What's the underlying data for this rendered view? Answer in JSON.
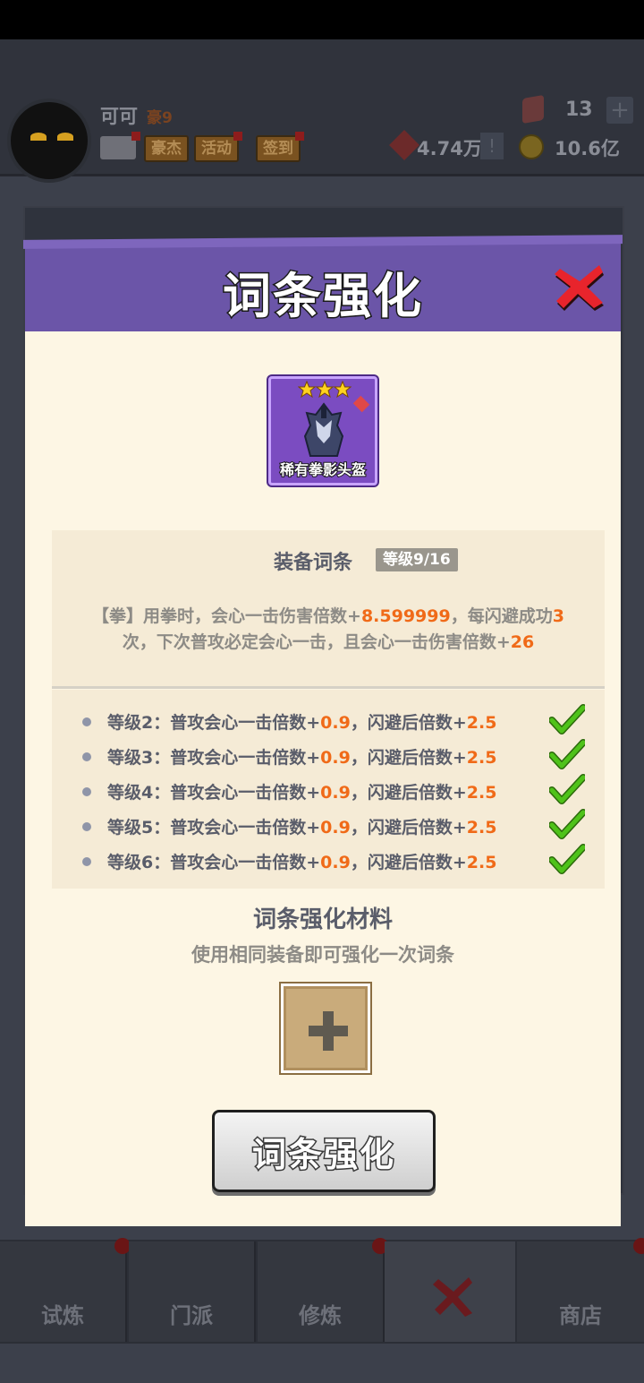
{
  "hud": {
    "player_name": "可可",
    "vip_label": "豪9",
    "tags": [
      "豪杰",
      "活动",
      "签到"
    ],
    "gem_count": "13",
    "plus_label": "+",
    "power_value": "4.74万",
    "excl_label": "!",
    "coin_value": "10.6亿"
  },
  "dialog": {
    "title": "词条强化",
    "item": {
      "name": "稀有拳影头盔",
      "stars": 3
    },
    "affix": {
      "title": "装备词条",
      "level_badge": "等级9/16",
      "desc": {
        "p1": "【拳】用拳时，会心一击伤害倍数+",
        "v1": "8.599999",
        "p2": "，每闪避成功",
        "v2": "3",
        "p3": "次，下次普攻必定会心一击，且会心一击伤害倍数+",
        "v3": "26"
      }
    },
    "levels": [
      {
        "prefix": "等级2：普攻会心一击倍数+",
        "v1": "0.9",
        "mid": "，闪避后倍数+",
        "v2": "2.5",
        "done": true
      },
      {
        "prefix": "等级3：普攻会心一击倍数+",
        "v1": "0.9",
        "mid": "，闪避后倍数+",
        "v2": "2.5",
        "done": true
      },
      {
        "prefix": "等级4：普攻会心一击倍数+",
        "v1": "0.9",
        "mid": "，闪避后倍数+",
        "v2": "2.5",
        "done": true
      },
      {
        "prefix": "等级5：普攻会心一击倍数+",
        "v1": "0.9",
        "mid": "，闪避后倍数+",
        "v2": "2.5",
        "done": true
      },
      {
        "prefix": "等级6：普攻会心一击倍数+",
        "v1": "0.9",
        "mid": "，闪避后倍数+",
        "v2": "2.5",
        "done": true
      }
    ],
    "material": {
      "title": "词条强化材料",
      "subtitle": "使用相同装备即可强化一次词条"
    },
    "action_button": "词条强化"
  },
  "bottom_nav": [
    "试炼",
    "门派",
    "修炼",
    "商店"
  ],
  "colors": {
    "accent_orange": "#f06a18",
    "header_purple": "#6b55a8",
    "panel_cream": "#fdf6e4",
    "check_green": "#4fc21a",
    "close_red": "#e8242c"
  }
}
